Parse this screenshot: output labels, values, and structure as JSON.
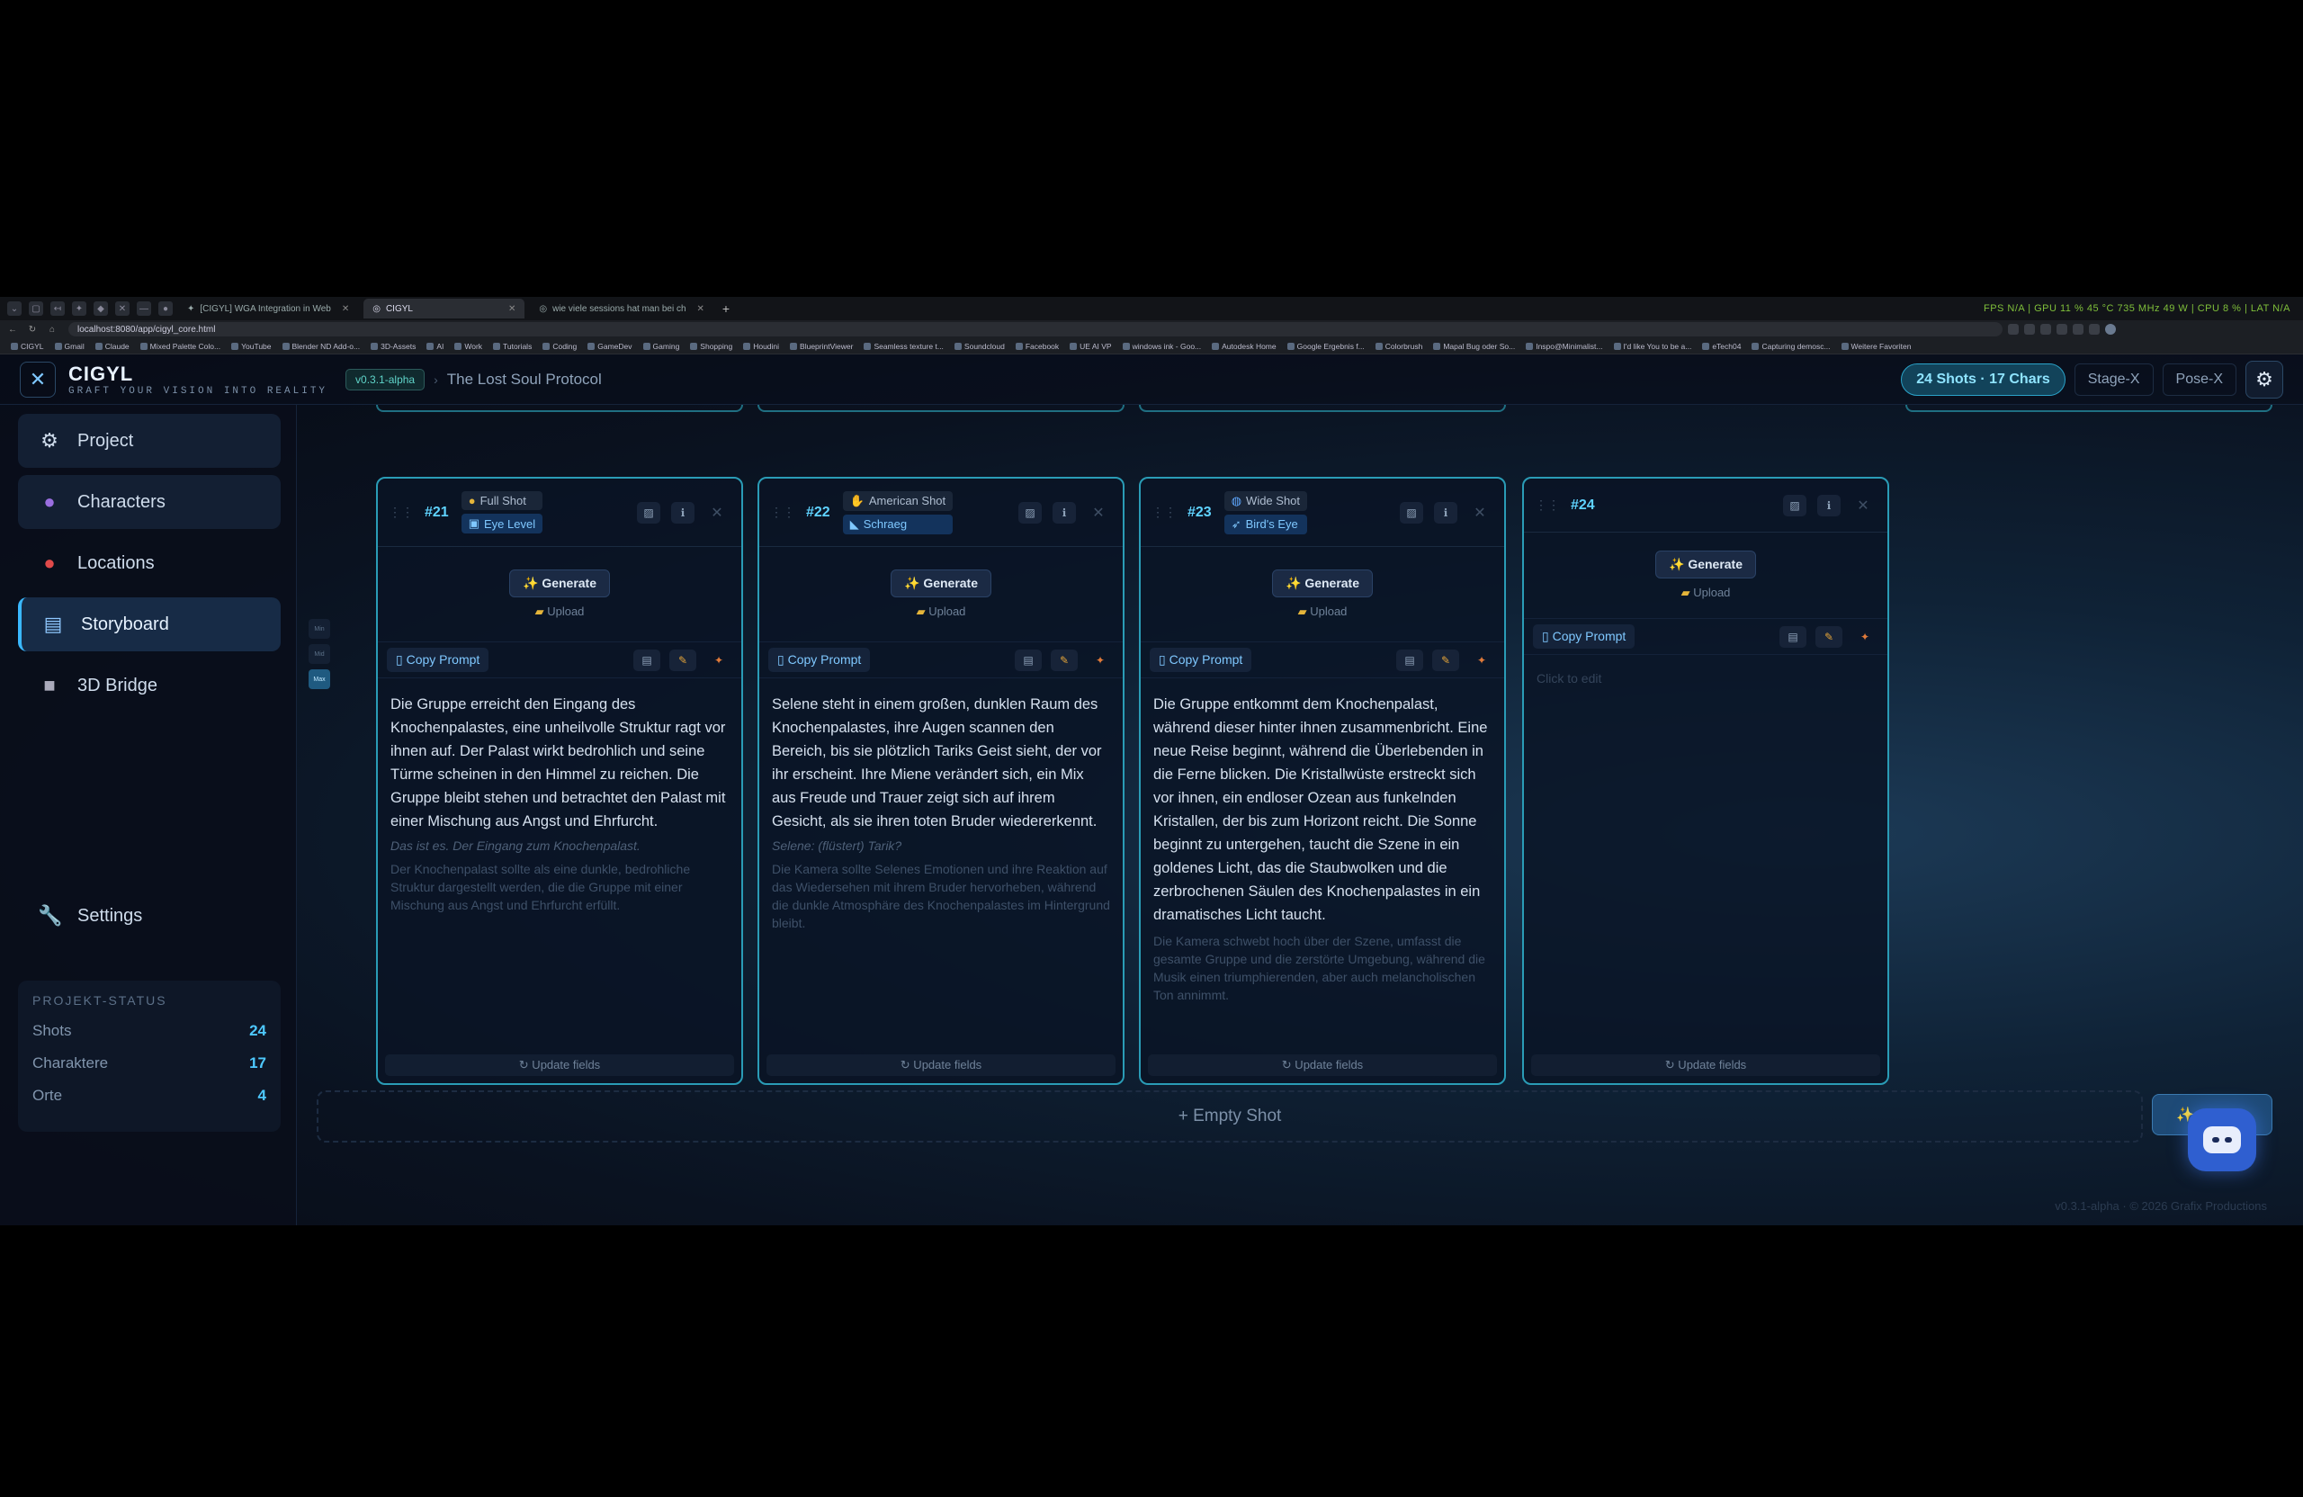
{
  "browser": {
    "tabs": [
      {
        "label": "[CIGYL] WGA Integration in Web"
      },
      {
        "label": "CIGYL",
        "active": true
      },
      {
        "label": "wie viele sessions hat man bei ch"
      }
    ],
    "new_tab": "+",
    "system_stats": "FPS N/A | GPU 11 % 45 °C 735 MHz 49 W | CPU 8 % | LAT N/A",
    "url": "localhost:8080/app/cigyl_core.html",
    "bookmarks": [
      "CIGYL",
      "Gmail",
      "Claude",
      "Mixed Palette Colo...",
      "YouTube",
      "Blender ND Add-o...",
      "3D-Assets",
      "AI",
      "Work",
      "Tutorials",
      "Coding",
      "GameDev",
      "Gaming",
      "Shopping",
      "Houdini",
      "BlueprintViewer",
      "Seamless texture t...",
      "Soundcloud",
      "Facebook",
      "UE AI VP",
      "windows ink - Goo...",
      "Autodesk Home",
      "Google Ergebnis f...",
      "Colorbrush",
      "Mapal Bug oder So...",
      "Inspo@Minimalist...",
      "I'd like You to be a...",
      "eTech04",
      "Capturing demosc...",
      "Weitere Favoriten"
    ]
  },
  "app": {
    "brand": "CIGYL",
    "tagline": "GRAFT YOUR VISION INTO REALITY",
    "version": "v0.3.1-alpha",
    "crumb_sep": "›",
    "project_name": "The Lost Soul Protocol",
    "stats_pill": "24 Shots · 17 Chars",
    "stage_btn": "Stage-X",
    "pose_btn": "Pose-X"
  },
  "sidebar": {
    "items": [
      {
        "label": "Project",
        "icon": "gear-icon"
      },
      {
        "label": "Characters",
        "icon": "person-icon"
      },
      {
        "label": "Locations",
        "icon": "pin-icon"
      },
      {
        "label": "Storyboard",
        "icon": "clapper-icon"
      },
      {
        "label": "3D Bridge",
        "icon": "cube-icon"
      }
    ],
    "settings_label": "Settings",
    "status": {
      "title": "PROJEKT-STATUS",
      "rows": [
        {
          "label": "Shots",
          "value": "24"
        },
        {
          "label": "Charaktere",
          "value": "17"
        },
        {
          "label": "Orte",
          "value": "4"
        }
      ]
    }
  },
  "rail": [
    "Min",
    "Mid",
    "Max"
  ],
  "cards": [
    {
      "num": "#21",
      "shot_type": "Full Shot",
      "angle": "Eye Level",
      "generate": "Generate",
      "upload": "Upload",
      "copy_prompt": "Copy Prompt",
      "description": "Die Gruppe erreicht den Eingang des Knochenpalastes, eine unheilvolle Struktur ragt vor ihnen auf. Der Palast wirkt bedrohlich und seine Türme scheinen in den Himmel zu reichen. Die Gruppe bleibt stehen und betrachtet den Palast mit einer Mischung aus Angst und Ehrfurcht.",
      "dialogue": "Das ist es. Der Eingang zum Knochenpalast.",
      "camera": "Der Knochenpalast sollte als eine dunkle, bedrohliche Struktur dargestellt werden, die die Gruppe mit einer Mischung aus Angst und Ehrfurcht erfüllt.",
      "update": "↻ Update fields"
    },
    {
      "num": "#22",
      "shot_type": "American Shot",
      "angle": "Schraeg",
      "generate": "Generate",
      "upload": "Upload",
      "copy_prompt": "Copy Prompt",
      "description": "Selene steht in einem großen, dunklen Raum des Knochenpalastes, ihre Augen scannen den Bereich, bis sie plötzlich Tariks Geist sieht, der vor ihr erscheint. Ihre Miene verändert sich, ein Mix aus Freude und Trauer zeigt sich auf ihrem Gesicht, als sie ihren toten Bruder wiedererkennt.",
      "dialogue": "Selene: (flüstert) Tarik?",
      "camera": "Die Kamera sollte Selenes Emotionen und ihre Reaktion auf das Wiedersehen mit ihrem Bruder hervorheben, während die dunkle Atmosphäre des Knochenpalastes im Hintergrund bleibt.",
      "update": "↻ Update fields"
    },
    {
      "num": "#23",
      "shot_type": "Wide Shot",
      "angle": "Bird's Eye",
      "generate": "Generate",
      "upload": "Upload",
      "copy_prompt": "Copy Prompt",
      "description": "Die Gruppe entkommt dem Knochenpalast, während dieser hinter ihnen zusammenbricht. Eine neue Reise beginnt, während die Überlebenden in die Ferne blicken. Die Kristallwüste erstreckt sich vor ihnen, ein endloser Ozean aus funkelnden Kristallen, der bis zum Horizont reicht. Die Sonne beginnt zu untergehen, taucht die Szene in ein goldenes Licht, das die Staubwolken und die zerbrochenen Säulen des Knochenpalastes in ein dramatisches Licht taucht.",
      "dialogue": "",
      "camera": "Die Kamera schwebt hoch über der Szene, umfasst die gesamte Gruppe und die zerstörte Umgebung, während die Musik einen triumphierenden, aber auch melancholischen Ton annimmt.",
      "update": "↻ Update fields"
    },
    {
      "num": "#24",
      "generate": "Generate",
      "upload": "Upload",
      "copy_prompt": "Copy Prompt",
      "placeholder": "Click to edit",
      "update": "↻ Update fields"
    }
  ],
  "empty_shot": "+ Empty Shot",
  "footer": "v0.3.1-alpha · © 2026 Grafix Productions",
  "colors": {
    "accent": "#2a9cb6",
    "highlight": "#4ec9ff",
    "bot": "#2f5fd0"
  }
}
